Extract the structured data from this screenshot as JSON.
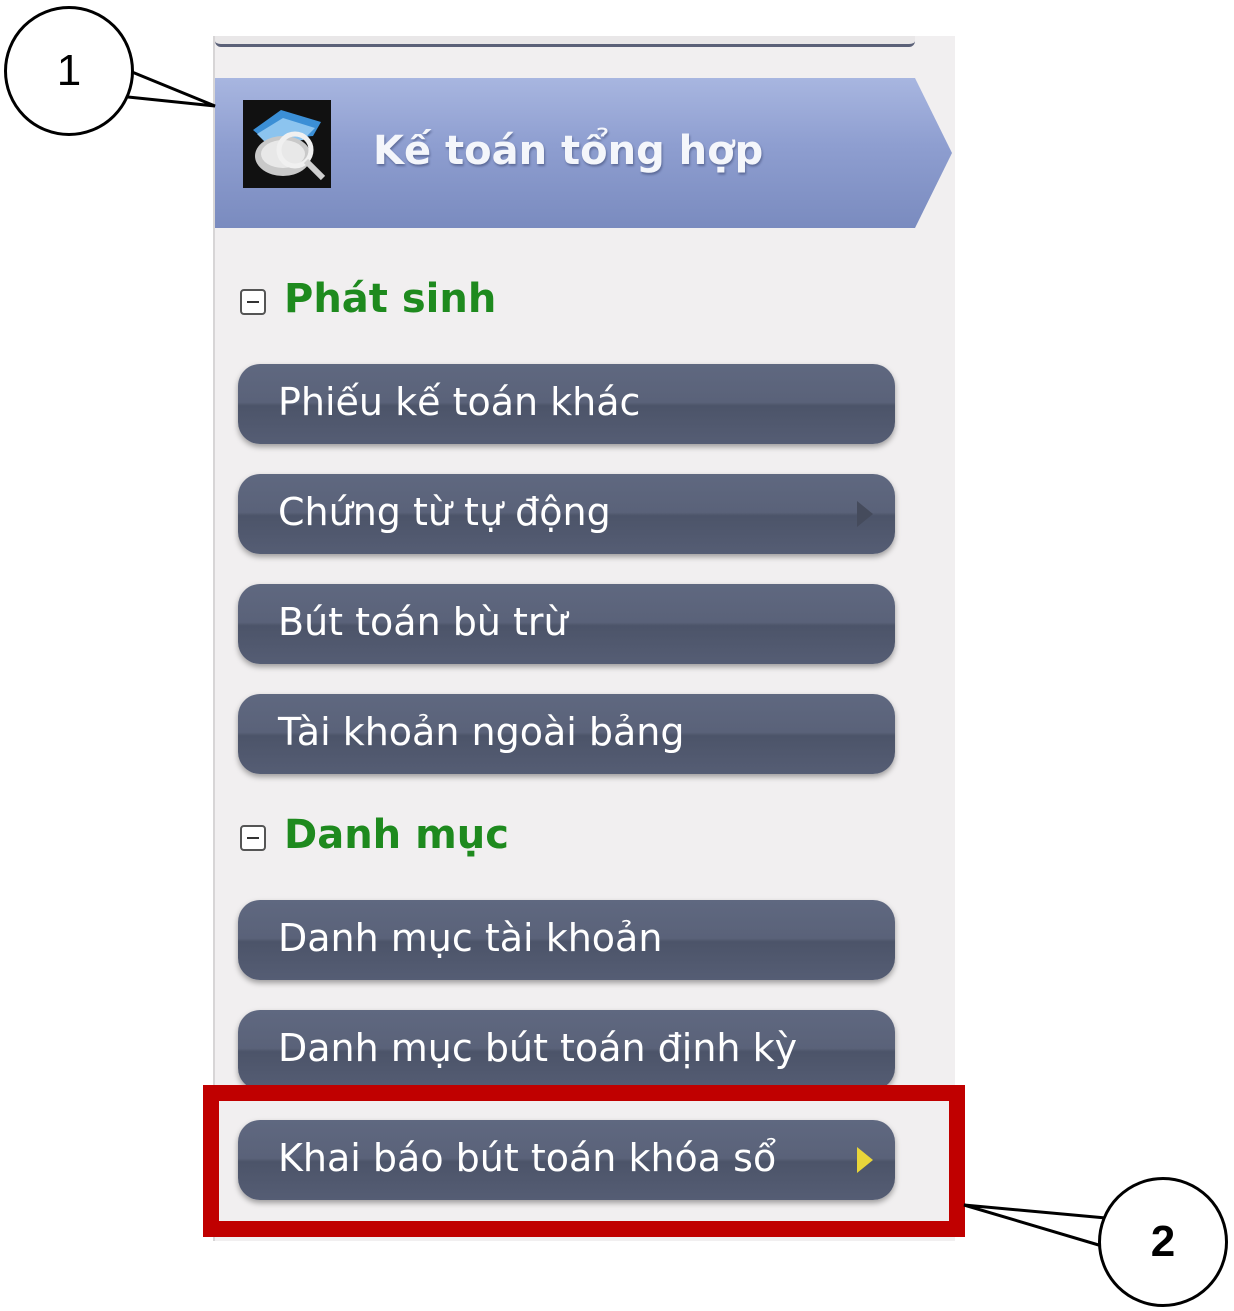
{
  "module": {
    "title": "Kế toán tổng hợp",
    "icon": "accounting-module-icon"
  },
  "sections": [
    {
      "title": "Phát sinh",
      "expanded": true,
      "items": [
        {
          "label": "Phiếu kế toán khác"
        },
        {
          "label": "Chứng từ tự động",
          "has_submenu": true
        },
        {
          "label": "Bút toán bù trừ"
        },
        {
          "label": "Tài khoản ngoài bảng"
        }
      ]
    },
    {
      "title": "Danh mục",
      "expanded": true,
      "items": [
        {
          "label": "Danh mục tài khoản"
        },
        {
          "label": "Danh mục bút toán định kỳ"
        },
        {
          "label": "Khai báo bút toán khóa sổ",
          "has_submenu": true,
          "highlighted": true
        }
      ]
    }
  ],
  "callouts": [
    "1",
    "2"
  ],
  "colors": {
    "header_gradient": "#8e9ed0",
    "section_title": "#1e8a1e",
    "button_bg": "#5a6279",
    "highlight": "#c00000",
    "submenu_arrow": "#e8d53a"
  }
}
